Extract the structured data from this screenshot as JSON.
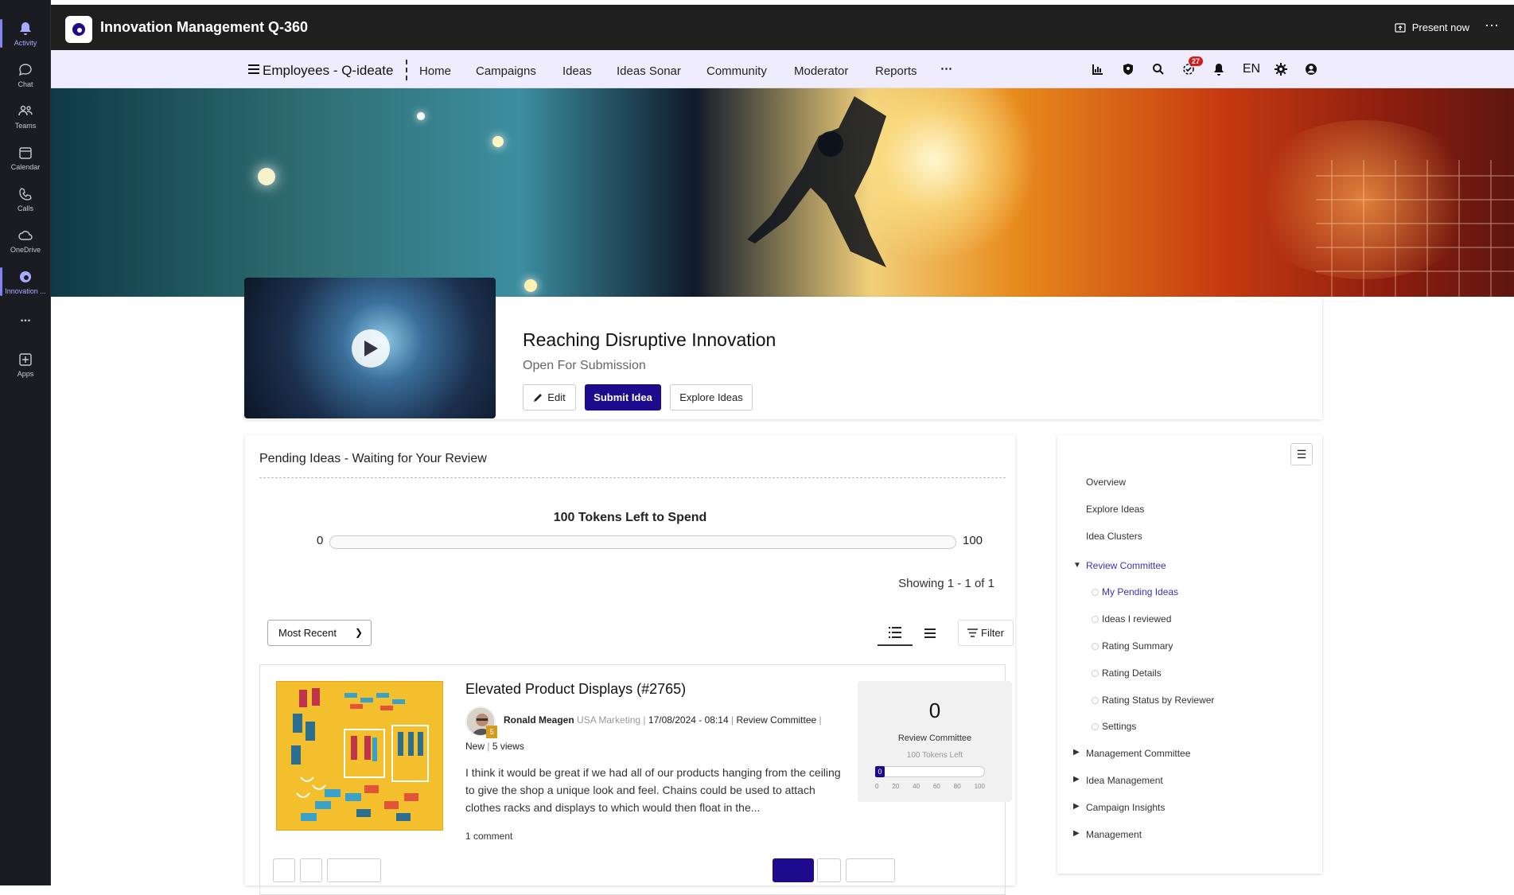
{
  "teams_rail": [
    {
      "label": "Activity",
      "icon": "bell-icon"
    },
    {
      "label": "Chat",
      "icon": "chat-icon"
    },
    {
      "label": "Teams",
      "icon": "teams-icon"
    },
    {
      "label": "Calendar",
      "icon": "calendar-icon"
    },
    {
      "label": "Calls",
      "icon": "phone-icon"
    },
    {
      "label": "OneDrive",
      "icon": "cloud-icon"
    },
    {
      "label": "Innovation ...",
      "icon": "innovation-app-icon"
    },
    {
      "label": "...",
      "icon": "more-icon"
    },
    {
      "label": "Apps",
      "icon": "apps-icon"
    }
  ],
  "window": {
    "title": "Innovation Management Q-360",
    "present_label": "Present now"
  },
  "nav": {
    "brand": "Employees - Q-ideate",
    "links": [
      "Home",
      "Campaigns",
      "Ideas",
      "Ideas Sonar",
      "Community",
      "Moderator",
      "Reports",
      "⋯"
    ],
    "notification_count": "27",
    "language": "EN"
  },
  "campaign": {
    "title": "Reaching Disruptive Innovation",
    "status": "Open For Submission",
    "edit_label": "Edit",
    "submit_label": "Submit Idea",
    "explore_label": "Explore Ideas"
  },
  "pending": {
    "title": "Pending Ideas - Waiting for Your Review",
    "tokens_label": "100 Tokens Left to Spend",
    "slider_min": "0",
    "slider_max": "100",
    "showing": "Showing 1 - 1 of 1",
    "sort_value": "Most Recent",
    "filter_label": "Filter"
  },
  "idea": {
    "title": "Elevated Product Displays (#2765)",
    "author": "Ronald Meagen",
    "department": "USA Marketing",
    "date": "17/08/2024 - 08:14",
    "stage": "Review Committee",
    "status": "New",
    "views": "5 views",
    "author_level": "5",
    "description": "I think it would be great if we had all of our products hanging from the ceiling to give the shop a unique look and feel. Chains could be used to attach clothes racks and displays to which would then float in the...",
    "comments": "1 comment",
    "score": "0",
    "score_label": "Review Committee",
    "tokens_left": "100 Tokens Left",
    "slider_value": "0",
    "slider_ticks": [
      "0",
      "20",
      "40",
      "60",
      "80",
      "100"
    ]
  },
  "sidebar": {
    "items": [
      {
        "label": "Overview"
      },
      {
        "label": "Explore Ideas"
      },
      {
        "label": "Idea Clusters"
      },
      {
        "label": "Review Committee"
      },
      {
        "label": "My Pending Ideas"
      },
      {
        "label": "Ideas I reviewed"
      },
      {
        "label": "Rating Summary"
      },
      {
        "label": "Rating Details"
      },
      {
        "label": "Rating Status by Reviewer"
      },
      {
        "label": "Settings"
      },
      {
        "label": "Management Committee"
      },
      {
        "label": "Idea Management"
      },
      {
        "label": "Campaign Insights"
      },
      {
        "label": "Management"
      }
    ]
  },
  "colors": {
    "primary": "#1e0a8c",
    "nav_bg": "#efedfd",
    "rail_bg": "#1b1c22",
    "active_link": "#3a33b5"
  }
}
